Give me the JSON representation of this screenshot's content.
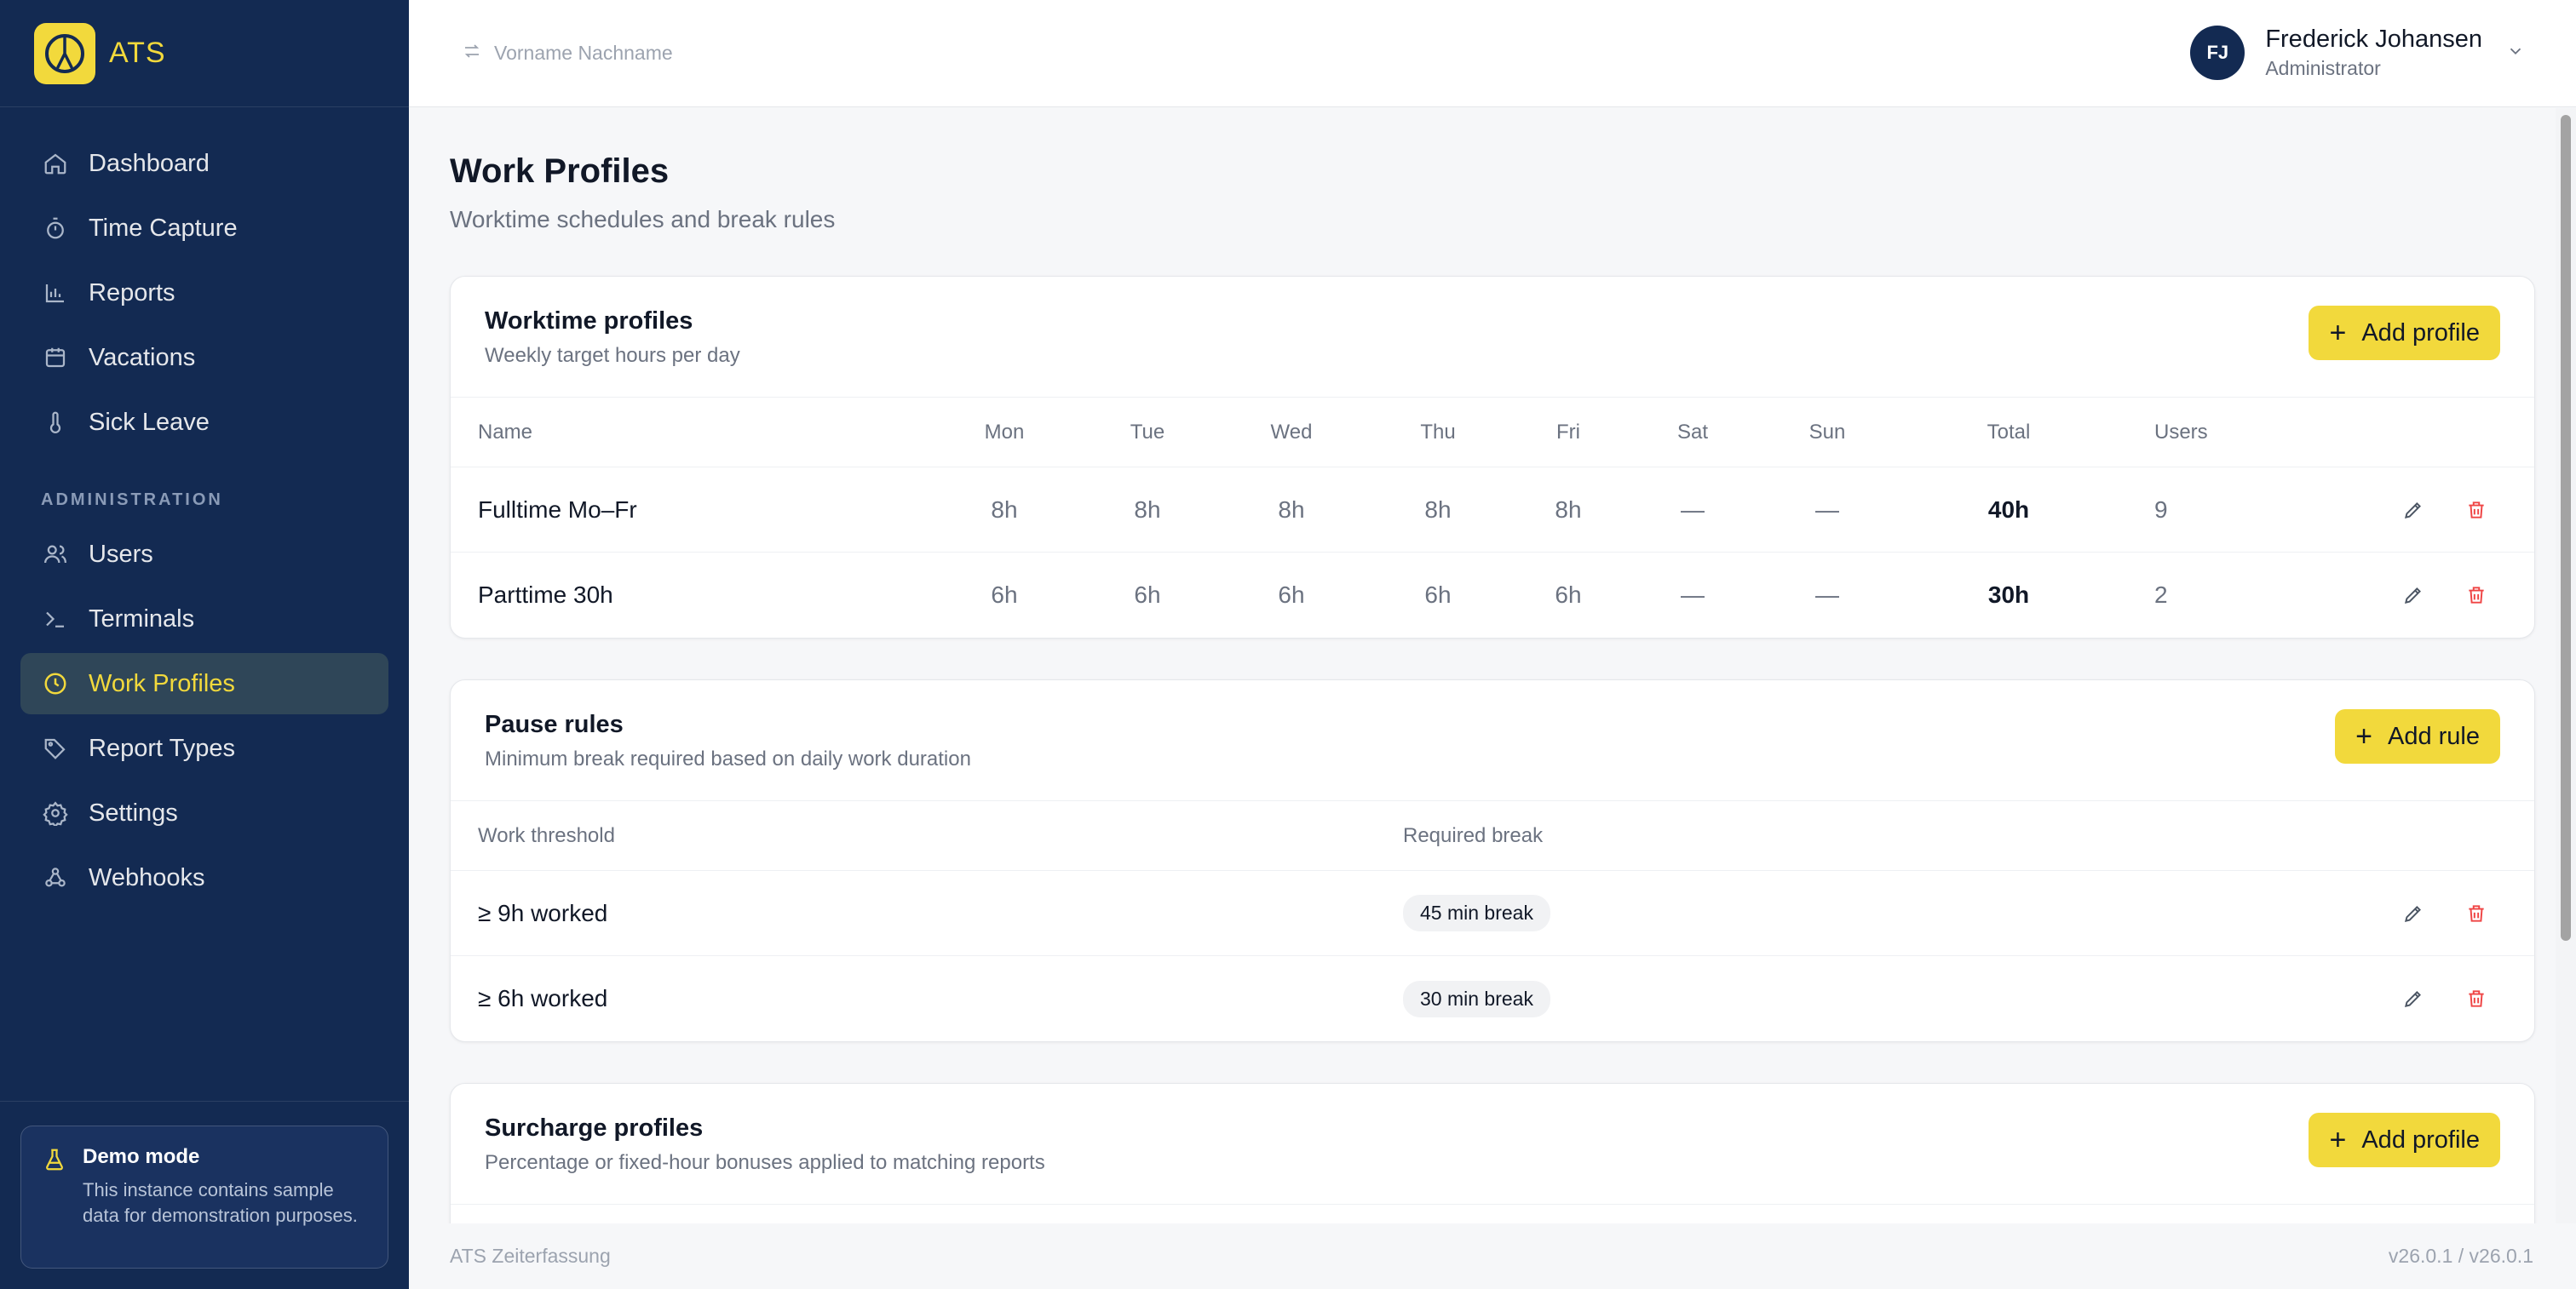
{
  "app": {
    "brand": "ATS"
  },
  "sidebar": {
    "items": [
      {
        "label": "Dashboard",
        "icon": "home-icon"
      },
      {
        "label": "Time Capture",
        "icon": "stopwatch-icon"
      },
      {
        "label": "Reports",
        "icon": "bar-chart-icon"
      },
      {
        "label": "Vacations",
        "icon": "calendar-icon"
      },
      {
        "label": "Sick Leave",
        "icon": "thermometer-icon"
      }
    ],
    "admin_section": "ADMINISTRATION",
    "admin_items": [
      {
        "label": "Users",
        "icon": "users-icon"
      },
      {
        "label": "Terminals",
        "icon": "terminal-icon"
      },
      {
        "label": "Work Profiles",
        "icon": "clock-icon",
        "active": true
      },
      {
        "label": "Report Types",
        "icon": "tag-icon"
      },
      {
        "label": "Settings",
        "icon": "gear-icon"
      },
      {
        "label": "Webhooks",
        "icon": "webhook-icon"
      }
    ],
    "demo": {
      "title": "Demo mode",
      "text": "This instance contains sample data for demonstration purposes."
    }
  },
  "topbar": {
    "switcher_placeholder": "Vorname Nachname",
    "user": {
      "initials": "FJ",
      "name": "Frederick Johansen",
      "role": "Administrator"
    }
  },
  "page": {
    "title": "Work Profiles",
    "subtitle": "Worktime schedules and break rules"
  },
  "worktime": {
    "title": "Worktime profiles",
    "subtitle": "Weekly target hours per day",
    "add_label": "Add profile",
    "columns": [
      "Name",
      "Mon",
      "Tue",
      "Wed",
      "Thu",
      "Fri",
      "Sat",
      "Sun",
      "Total",
      "Users"
    ],
    "rows": [
      {
        "name": "Fulltime Mo–Fr",
        "mon": "8h",
        "tue": "8h",
        "wed": "8h",
        "thu": "8h",
        "fri": "8h",
        "sat": "—",
        "sun": "—",
        "total": "40h",
        "users": "9"
      },
      {
        "name": "Parttime 30h",
        "mon": "6h",
        "tue": "6h",
        "wed": "6h",
        "thu": "6h",
        "fri": "6h",
        "sat": "—",
        "sun": "—",
        "total": "30h",
        "users": "2"
      }
    ]
  },
  "pause": {
    "title": "Pause rules",
    "subtitle": "Minimum break required based on daily work duration",
    "add_label": "Add rule",
    "columns": [
      "Work threshold",
      "Required break"
    ],
    "rows": [
      {
        "threshold": "≥ 9h worked",
        "break": "45 min break"
      },
      {
        "threshold": "≥ 6h worked",
        "break": "30 min break"
      }
    ]
  },
  "surcharge": {
    "title": "Surcharge profiles",
    "subtitle": "Percentage or fixed-hour bonuses applied to matching reports",
    "add_label": "Add profile"
  },
  "footer": {
    "app_name": "ATS Zeiterfassung",
    "version": "v26.0.1 / v26.0.1"
  },
  "colors": {
    "sidebar_bg": "#132a52",
    "accent": "#f2d93c",
    "active_bg": "#2f4658",
    "delete": "#ef4444"
  }
}
